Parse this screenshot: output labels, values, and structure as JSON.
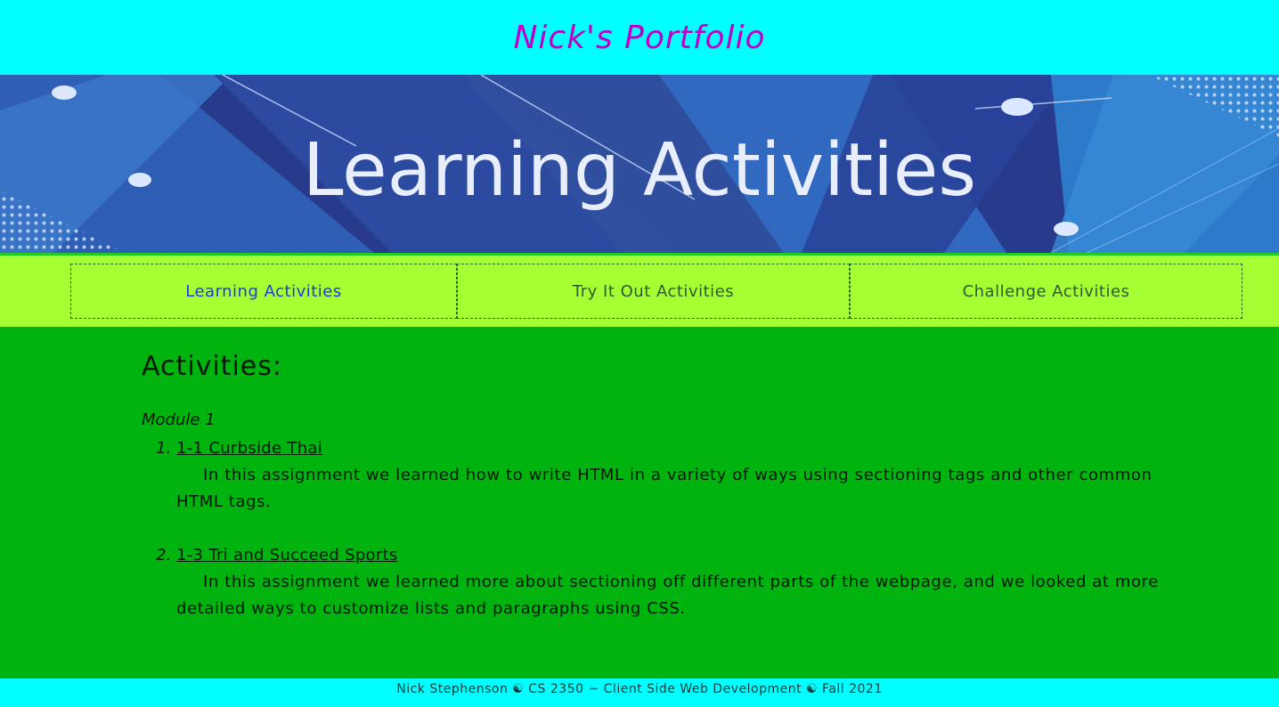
{
  "header": {
    "title": "Nick's Portfolio"
  },
  "banner": {
    "text": "Learning Activities"
  },
  "nav": {
    "items": [
      {
        "label": "Learning Activities",
        "active": true
      },
      {
        "label": "Try It Out Activities",
        "active": false
      },
      {
        "label": "Challenge Activities",
        "active": false
      }
    ]
  },
  "main": {
    "heading": "Activities:",
    "module": "Module 1",
    "activities": [
      {
        "number": "1.",
        "title": "1-1 Curbside Thai",
        "description": "In this assignment we learned how to write HTML in a variety of ways using sectioning tags and other common HTML tags."
      },
      {
        "number": "2.",
        "title": "1-3 Tri and Succeed Sports",
        "description": "In this assignment we learned more about sectioning off different parts of the webpage, and we looked at more detailed ways to customize lists and paragraphs using CSS."
      }
    ]
  },
  "footer": {
    "text": "Nick Stephenson ☯ CS 2350 ~ Client Side Web Development ☯ Fall 2021"
  },
  "colors": {
    "header_bg": "#00ffff",
    "title": "#c000c8",
    "nav_bg": "#a6ff33",
    "nav_active": "#1a3ddc",
    "main_bg": "#00b30f",
    "footer_bg": "#00ffff"
  }
}
